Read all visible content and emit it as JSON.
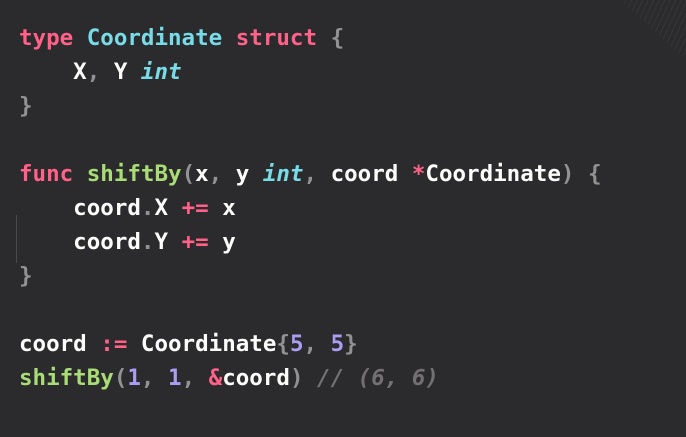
{
  "colors": {
    "background": "#2b2b2d",
    "keyword": "#ff6188",
    "function": "#a9dc76",
    "type": "#78dce8",
    "number": "#ab9df2",
    "default": "#fcfcfa",
    "punctuation": "#939293",
    "comment": "#727072"
  },
  "code": {
    "lines": [
      {
        "tokens": [
          {
            "text": "type",
            "c": "keyword"
          },
          {
            "text": " "
          },
          {
            "text": "Coordinate",
            "c": "type"
          },
          {
            "text": " "
          },
          {
            "text": "struct",
            "c": "keyword"
          },
          {
            "text": " "
          },
          {
            "text": "{",
            "c": "punctuation"
          }
        ]
      },
      {
        "tokens": [
          {
            "text": "    X"
          },
          {
            "text": ",",
            "c": "punctuation"
          },
          {
            "text": " Y "
          },
          {
            "text": "int",
            "c": "type",
            "i": true
          }
        ]
      },
      {
        "tokens": [
          {
            "text": "}",
            "c": "punctuation"
          }
        ]
      },
      {
        "tokens": []
      },
      {
        "tokens": [
          {
            "text": "func",
            "c": "keyword"
          },
          {
            "text": " "
          },
          {
            "text": "shiftBy",
            "c": "function"
          },
          {
            "text": "(",
            "c": "punctuation"
          },
          {
            "text": "x"
          },
          {
            "text": ",",
            "c": "punctuation"
          },
          {
            "text": " y "
          },
          {
            "text": "int",
            "c": "type",
            "i": true
          },
          {
            "text": ",",
            "c": "punctuation"
          },
          {
            "text": " coord "
          },
          {
            "text": "*",
            "c": "keyword"
          },
          {
            "text": "Coordinate"
          },
          {
            "text": ")",
            "c": "punctuation"
          },
          {
            "text": " "
          },
          {
            "text": "{",
            "c": "punctuation"
          }
        ]
      },
      {
        "tokens": [
          {
            "text": "    coord"
          },
          {
            "text": ".",
            "c": "punctuation"
          },
          {
            "text": "X "
          },
          {
            "text": "+=",
            "c": "keyword"
          },
          {
            "text": " x"
          }
        ]
      },
      {
        "tokens": [
          {
            "text": "    coord"
          },
          {
            "text": ".",
            "c": "punctuation"
          },
          {
            "text": "Y "
          },
          {
            "text": "+=",
            "c": "keyword"
          },
          {
            "text": " y"
          }
        ]
      },
      {
        "tokens": [
          {
            "text": "}",
            "c": "punctuation"
          }
        ]
      },
      {
        "tokens": []
      },
      {
        "tokens": [
          {
            "text": "coord "
          },
          {
            "text": ":=",
            "c": "keyword"
          },
          {
            "text": " Coordinate"
          },
          {
            "text": "{",
            "c": "punctuation"
          },
          {
            "text": "5",
            "c": "number"
          },
          {
            "text": ",",
            "c": "punctuation"
          },
          {
            "text": " "
          },
          {
            "text": "5",
            "c": "number"
          },
          {
            "text": "}",
            "c": "punctuation"
          }
        ]
      },
      {
        "tokens": [
          {
            "text": "shiftBy",
            "c": "function"
          },
          {
            "text": "(",
            "c": "punctuation"
          },
          {
            "text": "1",
            "c": "number"
          },
          {
            "text": ",",
            "c": "punctuation"
          },
          {
            "text": " "
          },
          {
            "text": "1",
            "c": "number"
          },
          {
            "text": ",",
            "c": "punctuation"
          },
          {
            "text": " "
          },
          {
            "text": "&",
            "c": "keyword"
          },
          {
            "text": "coord"
          },
          {
            "text": ")",
            "c": "punctuation"
          },
          {
            "text": " "
          },
          {
            "text": "// (6, 6)",
            "c": "comment",
            "i": true
          }
        ]
      }
    ]
  }
}
